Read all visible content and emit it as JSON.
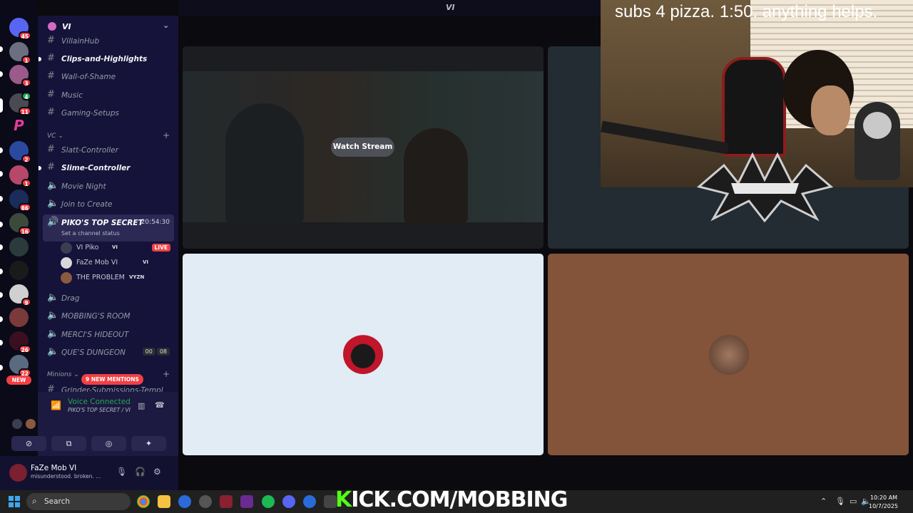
{
  "window": {
    "title": "VI"
  },
  "server": {
    "name": "VI"
  },
  "rail_badges": [
    "45",
    "1",
    "3",
    "4",
    "11",
    "2",
    "1",
    "86",
    "16",
    "9",
    "26",
    "22"
  ],
  "rail_new": "NEW",
  "channels": [
    {
      "name": "VillainHub",
      "type": "text",
      "bold": false
    },
    {
      "name": "Clips-and-Highlights",
      "type": "text",
      "bold": true
    },
    {
      "name": "Wall-of-Shame",
      "type": "text",
      "bold": false
    },
    {
      "name": "Music",
      "type": "text",
      "bold": false
    },
    {
      "name": "Gaming-Setups",
      "type": "text",
      "bold": false
    }
  ],
  "vc_category": "VC",
  "vc_channels": [
    {
      "name": "Slatt-Controller",
      "type": "text"
    },
    {
      "name": "Slime-Controller",
      "type": "text"
    },
    {
      "name": "Movie Night",
      "type": "voice"
    },
    {
      "name": "Join to Create",
      "type": "voice"
    }
  ],
  "active_channel": {
    "name": "PIKO'S TOP SECRET",
    "time": "20:54:30",
    "status": "Set a channel status"
  },
  "voice_users": [
    {
      "name": "VI Piko",
      "tag": "VI",
      "live": "LIVE"
    },
    {
      "name": "FaZe Mob VI",
      "tag": "VI"
    },
    {
      "name": "THE PROBLEM",
      "tag": "VYZN"
    }
  ],
  "more_channels": [
    {
      "name": "Drag"
    },
    {
      "name": "MOBBING'S ROOM"
    },
    {
      "name": "MERCI'S HIDEOUT"
    },
    {
      "name": "QUE'S DUNGEON",
      "counts": [
        "00",
        "08"
      ]
    }
  ],
  "minions_category": "Minions",
  "mentions": "9 NEW MENTIONS",
  "partial_channel": "Grinder-Submissions-Templ",
  "voice_panel": {
    "title": "Voice Connected",
    "subtitle": "PIKO'S TOP SECRET / VI"
  },
  "user": {
    "name": "FaZe Mob VI",
    "status": "misunderstood. broken. ..."
  },
  "stage": {
    "watch_label": "Watch Stream"
  },
  "overlay": {
    "cam_text": "subs 4 pizza. 1:50. anything helps.",
    "kick_text": "ICK.COM/MOBBING",
    "kick_k": "K"
  },
  "taskbar": {
    "search_placeholder": "Search",
    "time": "10:20 AM",
    "date": "10/7/2025"
  },
  "colors": {
    "accent_green": "#23a55a",
    "danger": "#f23f43",
    "kick_green": "#53fc18"
  }
}
